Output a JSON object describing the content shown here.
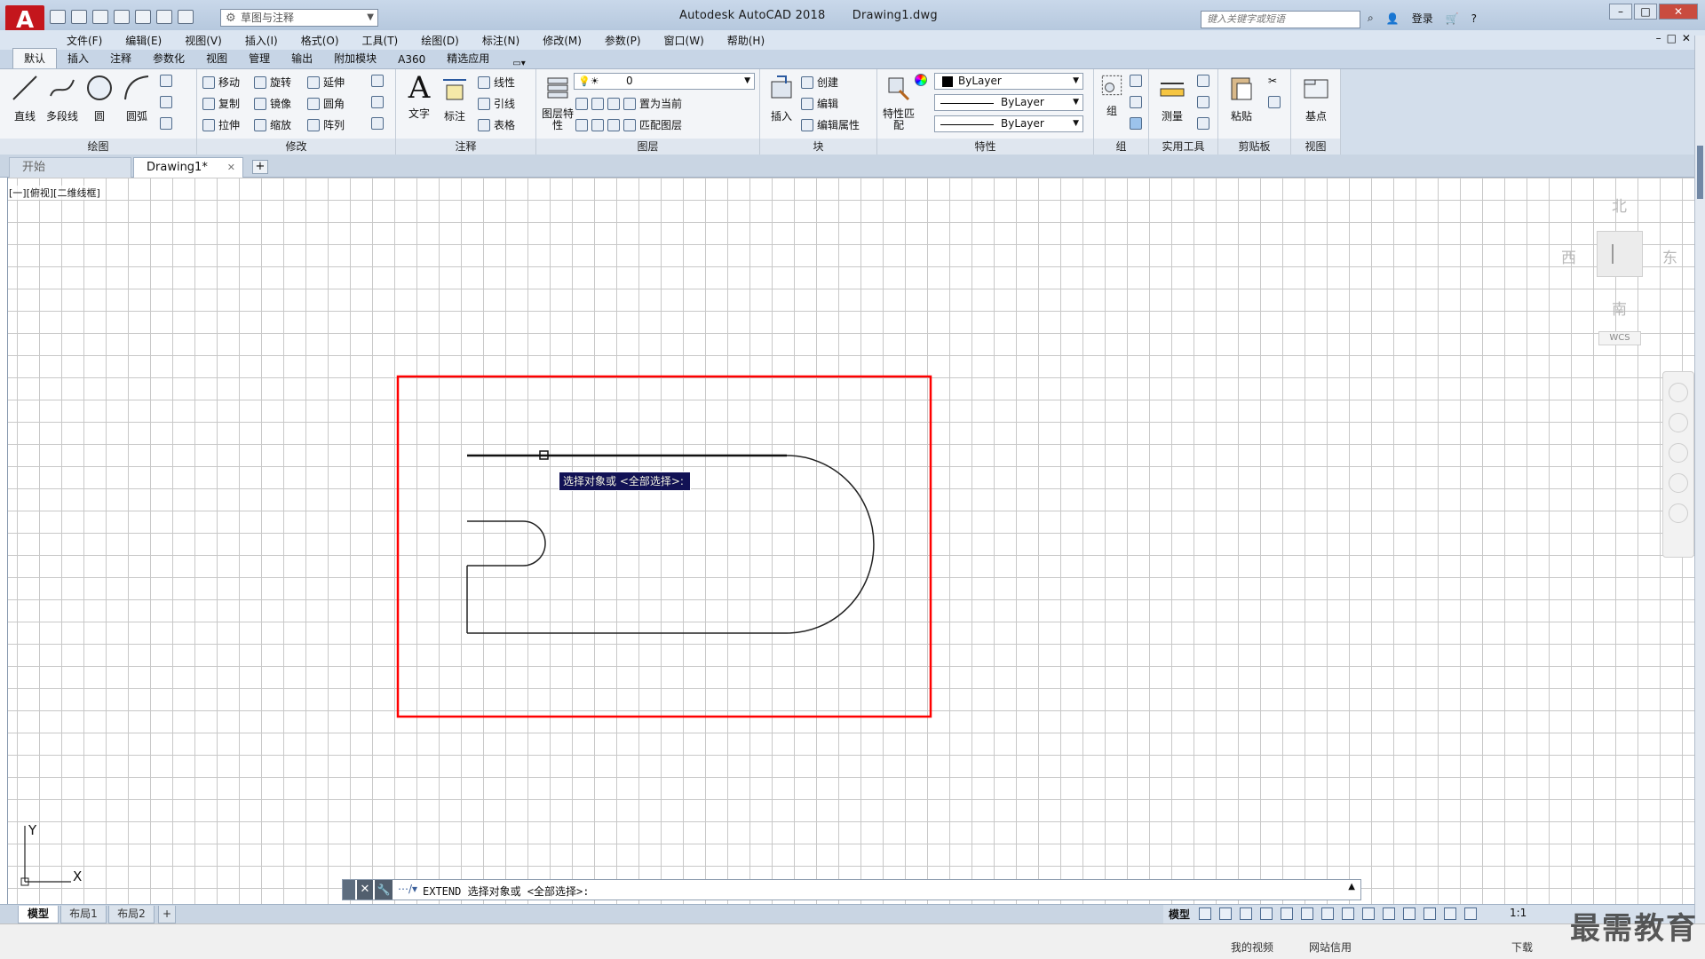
{
  "titlebar": {
    "app_logo": "A",
    "workspace": "草图与注释",
    "app_name": "Autodesk AutoCAD 2018",
    "file_name": "Drawing1.dwg",
    "search_placeholder": "键入关键字或短语",
    "login": "登录"
  },
  "menu": [
    "文件(F)",
    "编辑(E)",
    "视图(V)",
    "插入(I)",
    "格式(O)",
    "工具(T)",
    "绘图(D)",
    "标注(N)",
    "修改(M)",
    "参数(P)",
    "窗口(W)",
    "帮助(H)"
  ],
  "ribbon_tabs": [
    "默认",
    "插入",
    "注释",
    "参数化",
    "视图",
    "管理",
    "输出",
    "附加模块",
    "A360",
    "精选应用"
  ],
  "ribbon": {
    "draw": {
      "title": "绘图",
      "line": "直线",
      "polyline": "多段线",
      "circle": "圆",
      "arc": "圆弧"
    },
    "modify": {
      "title": "修改",
      "move": "移动",
      "rotate": "旋转",
      "extend": "延伸",
      "copy": "复制",
      "mirror": "镜像",
      "fillet": "圆角",
      "stretch": "拉伸",
      "scale": "缩放",
      "array": "阵列"
    },
    "annotation": {
      "title": "注释",
      "text": "文字",
      "dimension": "标注",
      "linear": "线性",
      "leader": "引线",
      "table": "表格"
    },
    "layers": {
      "title": "图层",
      "layer_props": "图层特性",
      "current_layer": "0",
      "make_current": "置为当前",
      "match_layer": "匹配图层"
    },
    "block": {
      "title": "块",
      "insert": "插入",
      "create": "创建",
      "edit": "编辑",
      "edit_attr": "编辑属性"
    },
    "properties": {
      "title": "特性",
      "match": "特性匹配",
      "color": "ByLayer",
      "linetype": "ByLayer",
      "lineweight": "ByLayer"
    },
    "groups": {
      "title": "组",
      "group": "组"
    },
    "utilities": {
      "title": "实用工具",
      "measure": "测量"
    },
    "clipboard": {
      "title": "剪贴板",
      "paste": "粘贴"
    },
    "view": {
      "title": "视图",
      "base": "基点"
    }
  },
  "doc_tabs": {
    "start": "开始",
    "current": "Drawing1*",
    "add": "+"
  },
  "viewport_label": "[一][俯视][二维线框]",
  "viewcube": {
    "north": "北",
    "south": "南",
    "east": "东",
    "west": "西",
    "wcs": "WCS"
  },
  "tooltip": "选择对象或 <全部选择>:",
  "ucs": {
    "x": "X",
    "y": "Y"
  },
  "command_line": {
    "text": "EXTEND 选择对象或 <全部选择>:"
  },
  "layout_tabs": [
    "模型",
    "布局1",
    "布局2",
    "+"
  ],
  "statusbar": {
    "model": "模型",
    "scale": "1:1"
  },
  "taskbar": {
    "video": "我的视频",
    "credit": "网站信用",
    "download": "下载"
  },
  "watermark": "最需教育",
  "colors": {
    "selection_box": "#ff0000",
    "tooltip_bg": "#121255",
    "accent": "#c4161c"
  }
}
